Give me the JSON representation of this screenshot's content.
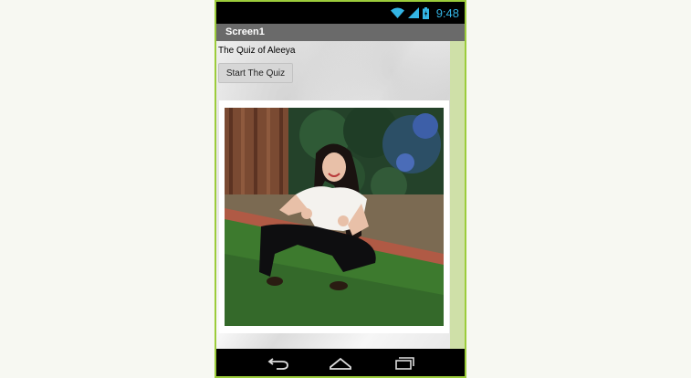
{
  "status_bar": {
    "time": "9:48",
    "icons": [
      "wifi-icon",
      "signal-icon",
      "battery-icon"
    ]
  },
  "app": {
    "screen_title": "Screen1",
    "quiz_label": "The Quiz of Aleeya",
    "start_button_label": "Start The Quiz"
  },
  "photo": {
    "subject": "woman-crouching-on-grass"
  },
  "nav": {
    "buttons": [
      "back-icon",
      "home-icon",
      "recent-apps-icon"
    ]
  },
  "colors": {
    "status_time": "#33b5e5",
    "title_bar": "#6a6a6a",
    "phone_border": "#9ccc3b",
    "scroll_strip": "#cfe0a8"
  }
}
